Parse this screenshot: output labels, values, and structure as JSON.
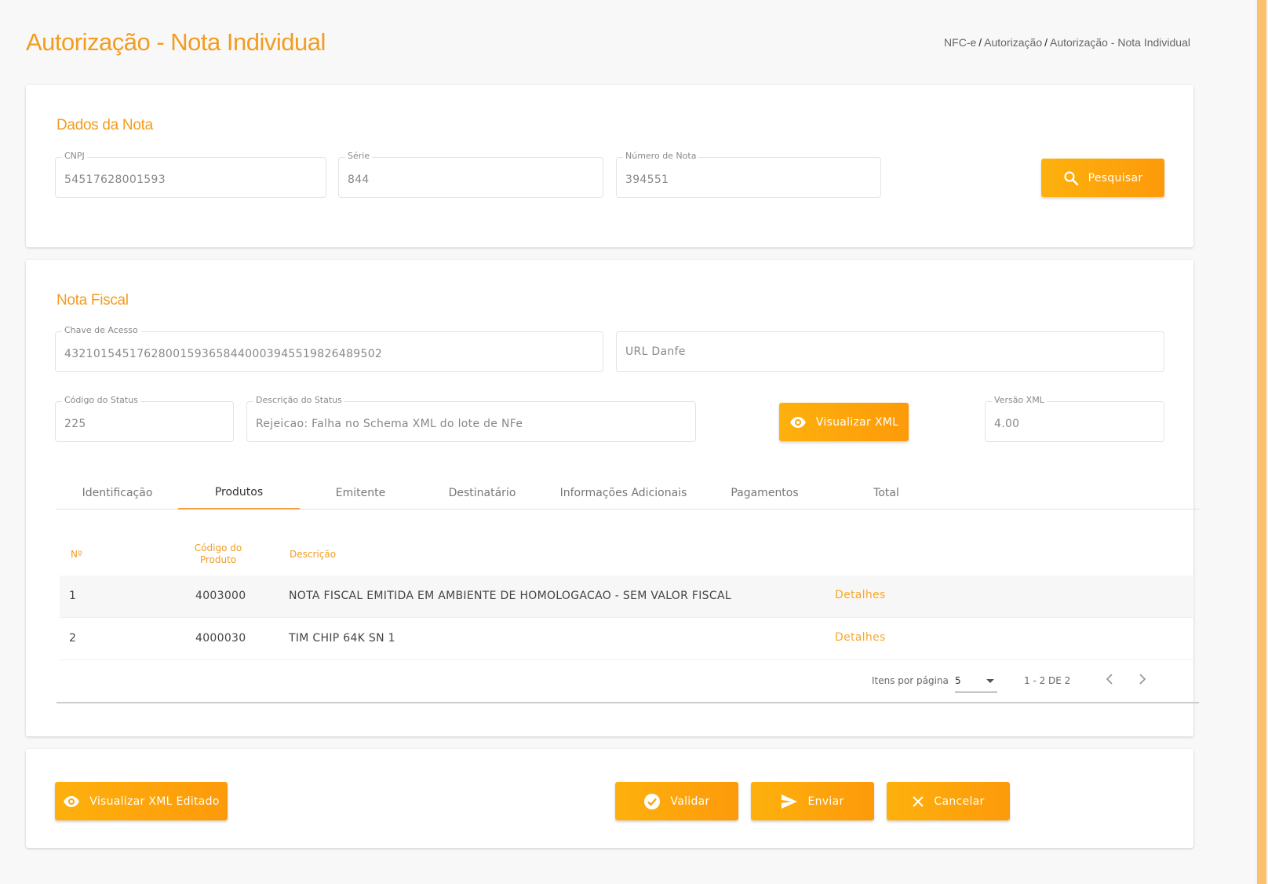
{
  "header": {
    "title": "Autorização - Nota Individual",
    "breadcrumb": [
      "NFC-e",
      "Autorização",
      "Autorização - Nota Individual"
    ],
    "separator": "/"
  },
  "dados_nota": {
    "title": "Dados da Nota",
    "cnpj": {
      "label": "CNPJ",
      "value": "54517628001593"
    },
    "serie": {
      "label": "Série",
      "value": "844"
    },
    "numero": {
      "label": "Número de Nota",
      "value": "394551"
    },
    "search_button": "Pesquisar"
  },
  "nota_fiscal": {
    "title": "Nota Fiscal",
    "chave": {
      "label": "Chave de Acesso",
      "value": "43210154517628001593658440003945519826489502"
    },
    "url_danfe": {
      "placeholder": "URL Danfe"
    },
    "codigo_status": {
      "label": "Código do Status",
      "value": "225"
    },
    "descricao_status": {
      "label": "Descrição do Status",
      "value": "Rejeicao: Falha no Schema XML do lote de NFe"
    },
    "visualizar_xml_button": "Visualizar XML",
    "versao_xml": {
      "label": "Versão XML",
      "value": "4.00"
    },
    "tabs": [
      "Identificação",
      "Produtos",
      "Emitente",
      "Destinatário",
      "Informações Adicionais",
      "Pagamentos",
      "Total"
    ],
    "active_tab": "Produtos",
    "table": {
      "headers": {
        "no": "Nº",
        "codigo_line1": "Código do",
        "codigo_line2": "Produto",
        "descricao": "Descrição"
      },
      "rows": [
        {
          "no": "1",
          "codigo": "4003000",
          "descricao": "NOTA FISCAL EMITIDA EM AMBIENTE DE HOMOLOGACAO - SEM VALOR FISCAL",
          "action": "Detalhes"
        },
        {
          "no": "2",
          "codigo": "4000030",
          "descricao": "TIM CHIP 64K SN 1",
          "action": "Detalhes"
        }
      ]
    },
    "paginator": {
      "items_label": "Itens por página",
      "page_size": "5",
      "range": "1 - 2 DE 2"
    }
  },
  "actions": {
    "visualizar_editado": "Visualizar XML Editado",
    "validar": "Validar",
    "enviar": "Enviar",
    "cancelar": "Cancelar"
  },
  "colors": {
    "accent": "#f39c1f",
    "button": "#fda60c"
  }
}
